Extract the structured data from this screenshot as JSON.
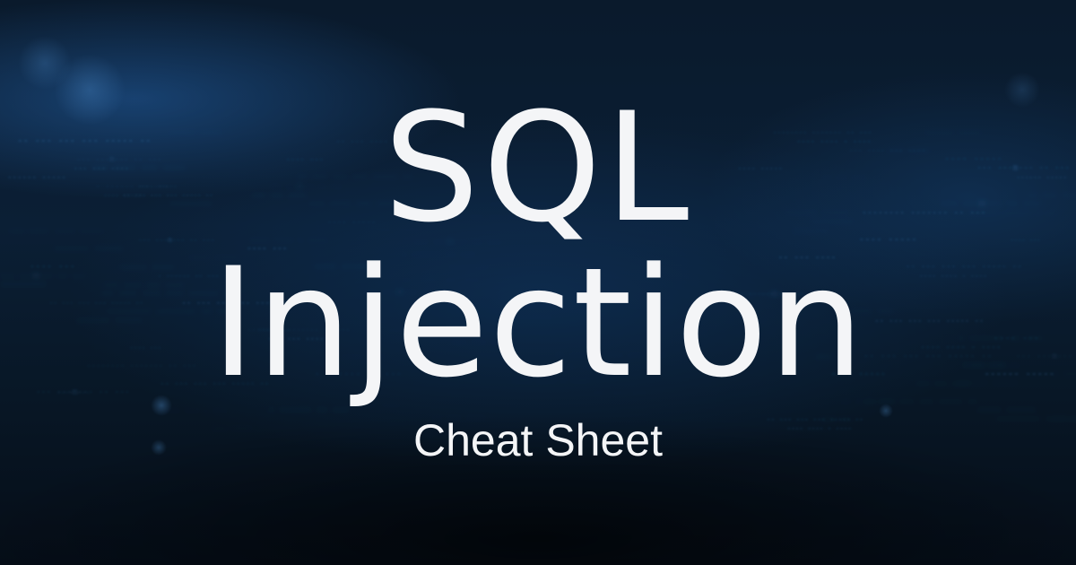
{
  "banner": {
    "title_line_1": "SQL",
    "title_line_2": "Injection",
    "subtitle": "Cheat Sheet"
  },
  "background": {
    "code_fragments": [
      "--- ---m--- -- ---",
      "-- --- --- --- ----- --",
      "------ -----",
      "---- ---",
      "- ------ -- ---",
      "---- -----",
      "-------- ------- -- ---",
      "-- --- ----",
      "---- ---- - ----",
      "--- --- ----",
      "------ -----",
      "--------",
      "--- ---- --- ----"
    ]
  },
  "colors": {
    "title_text": "#f4f5f7",
    "background_dark": "#06101c",
    "background_blue": "#0b1f35",
    "code_glow": "#3f86c8"
  }
}
